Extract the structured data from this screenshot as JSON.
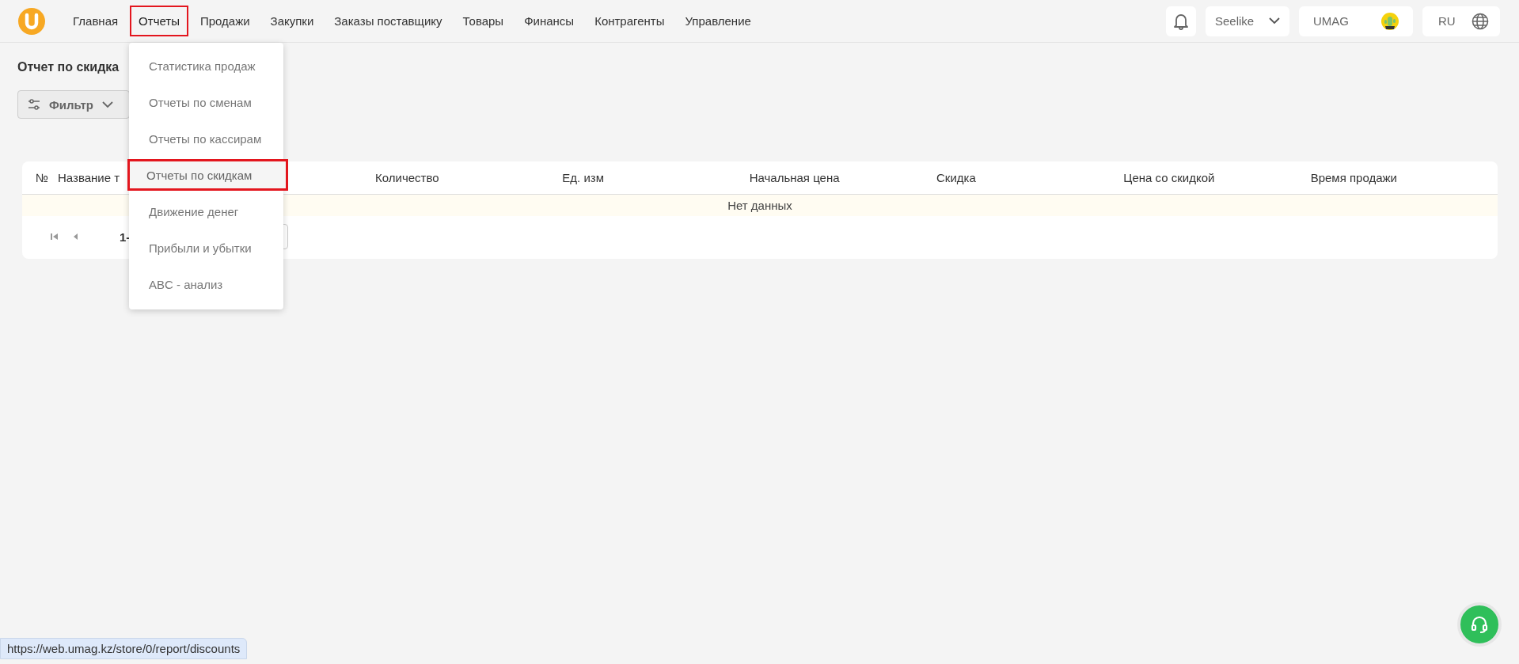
{
  "nav": [
    {
      "label": "Главная",
      "selected": false,
      "annotated": false
    },
    {
      "label": "Отчеты",
      "selected": true,
      "annotated": true
    },
    {
      "label": "Продажи",
      "selected": false,
      "annotated": false
    },
    {
      "label": "Закупки",
      "selected": false,
      "annotated": false
    },
    {
      "label": "Заказы поставщику",
      "selected": false,
      "annotated": false
    },
    {
      "label": "Товары",
      "selected": false,
      "annotated": false
    },
    {
      "label": "Финансы",
      "selected": false,
      "annotated": false
    },
    {
      "label": "Контрагенты",
      "selected": false,
      "annotated": false
    },
    {
      "label": "Управление",
      "selected": false,
      "annotated": false
    }
  ],
  "header_right": {
    "store": "Seelike",
    "user": "UMAG",
    "language": "RU"
  },
  "page_title": "Отчет по скидка",
  "filter_button": "Фильтр",
  "table": {
    "columns": [
      "№",
      "Название т",
      "Количество",
      "Ед. изм",
      "Начальная цена",
      "Скидка",
      "Цена со скидкой",
      "Время продажи"
    ],
    "empty_text": "Нет данных",
    "pagination_range": "1-"
  },
  "dropdown": [
    {
      "label": "Статистика продаж",
      "selected": false,
      "annotated": false
    },
    {
      "label": "Отчеты по сменам",
      "selected": false,
      "annotated": false
    },
    {
      "label": "Отчеты по кассирам",
      "selected": false,
      "annotated": false
    },
    {
      "label": "Отчеты по скидкам",
      "selected": true,
      "annotated": true
    },
    {
      "label": "Движение денег",
      "selected": false,
      "annotated": false
    },
    {
      "label": "Прибыли и убытки",
      "selected": false,
      "annotated": false
    },
    {
      "label": "ABC - анализ",
      "selected": false,
      "annotated": false
    }
  ],
  "status_url": "https://web.umag.kz/store/0/report/discounts"
}
